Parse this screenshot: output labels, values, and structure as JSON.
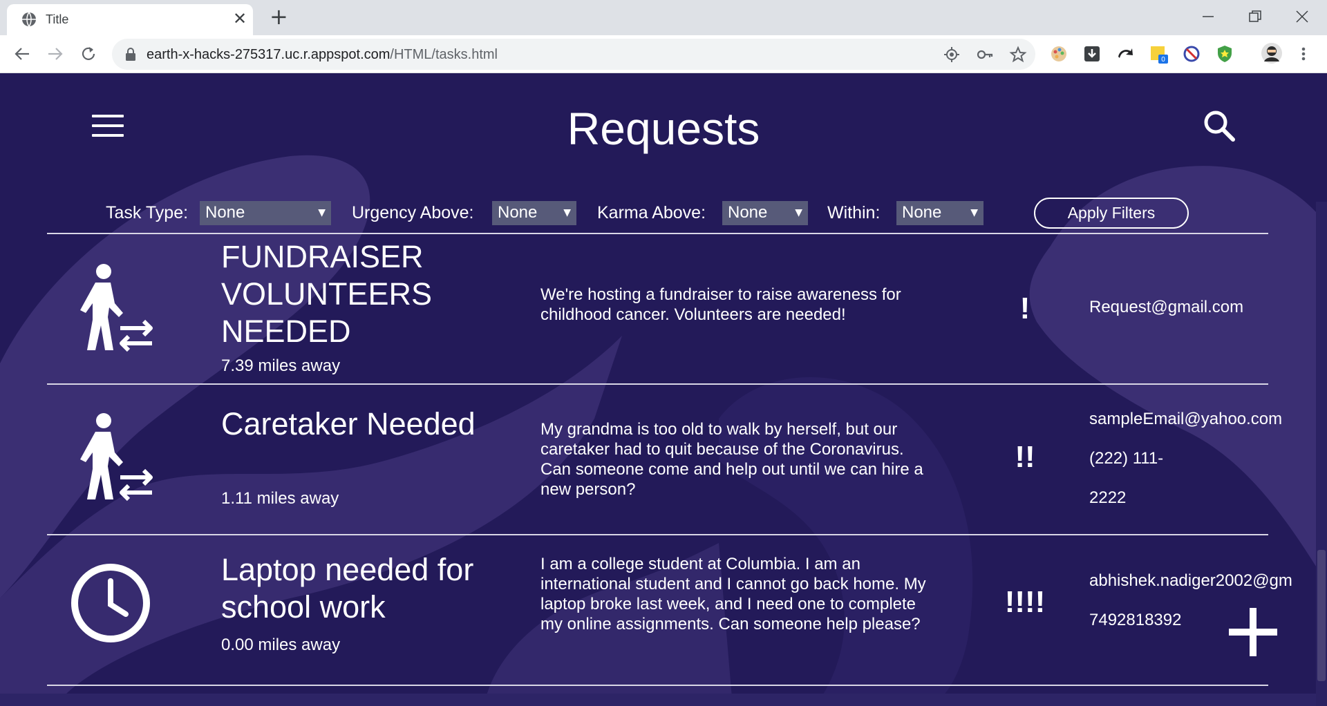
{
  "browser": {
    "tab_title": "Title",
    "tab_close": "✕",
    "new_tab": "+",
    "url_host": "earth-x-hacks-275317.uc.r.appspot.com",
    "url_path": "/HTML/tasks.html",
    "extension_badge": "0"
  },
  "page": {
    "title": "Requests",
    "filters": [
      {
        "label": "Task Type:",
        "value": "None"
      },
      {
        "label": "Urgency Above:",
        "value": "None"
      },
      {
        "label": "Karma Above:",
        "value": "None"
      },
      {
        "label": "Within:",
        "value": "None"
      }
    ],
    "apply_label": "Apply Filters"
  },
  "requests": [
    {
      "icon": "person-exchange-icon",
      "title": "FUNDRAISER VOLUNTEERS NEEDED",
      "distance": "7.39 miles away",
      "description": "We're hosting a fundraiser to raise awareness for childhood cancer. Volunteers are needed!",
      "urgency": "!",
      "contact": [
        "Request@gmail.com"
      ]
    },
    {
      "icon": "person-exchange-icon",
      "title": "Caretaker Needed",
      "distance": "1.11 miles away",
      "description": "My grandma is too old to walk by herself, but our caretaker had to quit because of the Coronavirus. Can someone come and help out until we can hire a new person?",
      "urgency": "!!",
      "contact": [
        "sampleEmail@yahoo.com",
        "(222) 111-",
        "2222"
      ]
    },
    {
      "icon": "clock-icon",
      "title": "Laptop needed for school work",
      "distance": "0.00 miles away",
      "description": "I am a college student at Columbia. I am an international student and I cannot go back home. My laptop broke last week, and I need one to complete my online assignments. Can someone help please?",
      "urgency": "!!!!",
      "contact": [
        "abhishek.nadiger2002@gm",
        "7492818392"
      ]
    }
  ],
  "colors": {
    "background": "#231a59",
    "accent_shape": "#3b2f73",
    "select_bg": "#575a79"
  }
}
